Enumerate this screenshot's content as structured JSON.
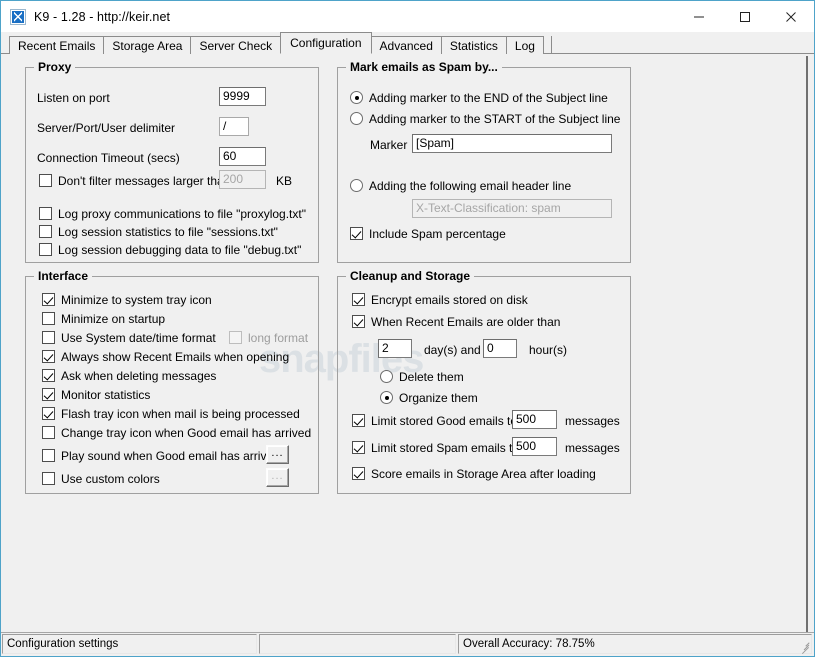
{
  "window": {
    "title": "K9 - 1.28 - http://keir.net",
    "icon": "k9-app-icon",
    "minimize": "–",
    "maximize": "□",
    "close": "✕"
  },
  "tabs": [
    {
      "label": "Recent Emails",
      "selected": false
    },
    {
      "label": "Storage Area",
      "selected": false
    },
    {
      "label": "Server Check",
      "selected": false
    },
    {
      "label": "Configuration",
      "selected": true
    },
    {
      "label": "Advanced",
      "selected": false
    },
    {
      "label": "Statistics",
      "selected": false
    },
    {
      "label": "Log",
      "selected": false
    }
  ],
  "watermark": "snapfiles",
  "proxy": {
    "legend": "Proxy",
    "listen_port_label": "Listen on port",
    "listen_port_value": "9999",
    "delimiter_label": "Server/Port/User delimiter",
    "delimiter_value": "/",
    "timeout_label": "Connection Timeout (secs)",
    "timeout_value": "60",
    "dont_filter_label": "Don't filter messages larger than",
    "dont_filter_checked": false,
    "dont_filter_value": "200",
    "dont_filter_unit": "KB",
    "log_proxy_label": "Log proxy communications to file \"proxylog.txt\"",
    "log_proxy_checked": false,
    "log_stats_label": "Log session statistics to file \"sessions.txt\"",
    "log_stats_checked": false,
    "log_debug_label": "Log session debugging data to file \"debug.txt\"",
    "log_debug_checked": false
  },
  "interface": {
    "legend": "Interface",
    "items": [
      {
        "label": "Minimize to system tray icon",
        "checked": true,
        "disabled": false
      },
      {
        "label": "Minimize on startup",
        "checked": false,
        "disabled": false
      },
      {
        "label": "Use System date/time format",
        "checked": false,
        "disabled": false
      },
      {
        "label": "Always show Recent Emails when opening",
        "checked": true,
        "disabled": false
      },
      {
        "label": "Ask when deleting messages",
        "checked": true,
        "disabled": false
      },
      {
        "label": "Monitor statistics",
        "checked": true,
        "disabled": false
      },
      {
        "label": "Flash tray icon when mail is being processed",
        "checked": true,
        "disabled": false
      },
      {
        "label": "Change tray icon when Good email has arrived",
        "checked": false,
        "disabled": false
      },
      {
        "label": "Play sound when Good email has arrived",
        "checked": false,
        "disabled": false
      },
      {
        "label": "Use custom colors",
        "checked": false,
        "disabled": false
      }
    ],
    "long_format_label": "long format",
    "long_format_checked": false,
    "long_format_disabled": true,
    "browse_sound_label": "...",
    "browse_colors_label": "..."
  },
  "spam_marking": {
    "legend": "Mark emails as Spam by...",
    "option_end_label": "Adding marker to the END of the Subject line",
    "option_end_selected": true,
    "option_start_label": "Adding marker to the START of the Subject line",
    "option_start_selected": false,
    "marker_label": "Marker",
    "marker_value": "[Spam]",
    "option_header_label": "Adding the following email header line",
    "option_header_selected": false,
    "header_value": "X-Text-Classification: spam",
    "include_pct_label": "Include Spam percentage",
    "include_pct_checked": true
  },
  "cleanup": {
    "legend": "Cleanup and Storage",
    "encrypt_label": "Encrypt emails stored on disk",
    "encrypt_checked": true,
    "older_than_label": "When Recent Emails are older than",
    "older_than_checked": true,
    "days_value": "2",
    "days_label": "day(s) and",
    "hours_value": "0",
    "hours_label": "hour(s)",
    "delete_label": "Delete them",
    "delete_selected": false,
    "organize_label": "Organize them",
    "organize_selected": true,
    "limit_good_label": "Limit stored Good emails to",
    "limit_good_checked": true,
    "limit_good_value": "500",
    "limit_good_unit": "messages",
    "limit_spam_label": "Limit stored Spam emails to",
    "limit_spam_checked": true,
    "limit_spam_value": "500",
    "limit_spam_unit": "messages",
    "score_label": "Score emails in Storage Area after loading",
    "score_checked": true
  },
  "statusbar": {
    "pane1": "Configuration settings",
    "pane2": "",
    "pane3": "Overall Accuracy: 78.75%"
  },
  "colors": {
    "window_border": "#4ea3c9",
    "face": "#f0f0f0",
    "group_border": "#a0a0a0",
    "field_border": "#7a7a7a",
    "disabled_text": "#a6a6a6"
  }
}
